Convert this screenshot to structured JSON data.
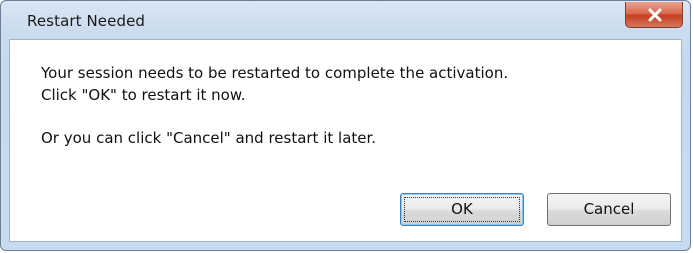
{
  "dialog": {
    "title": "Restart Needed",
    "message_line1": "Your session needs to be restarted to complete the activation.",
    "message_line2": "Click \"OK\" to restart it now.",
    "message_line3": "Or you can click \"Cancel\" and restart it later.",
    "ok_label": "OK",
    "cancel_label": "Cancel",
    "close_icon": "close-icon",
    "colors": {
      "frame": "#c6d8ec",
      "close_button": "#d9694f",
      "ok_focus_border": "#3c7fb1"
    }
  }
}
